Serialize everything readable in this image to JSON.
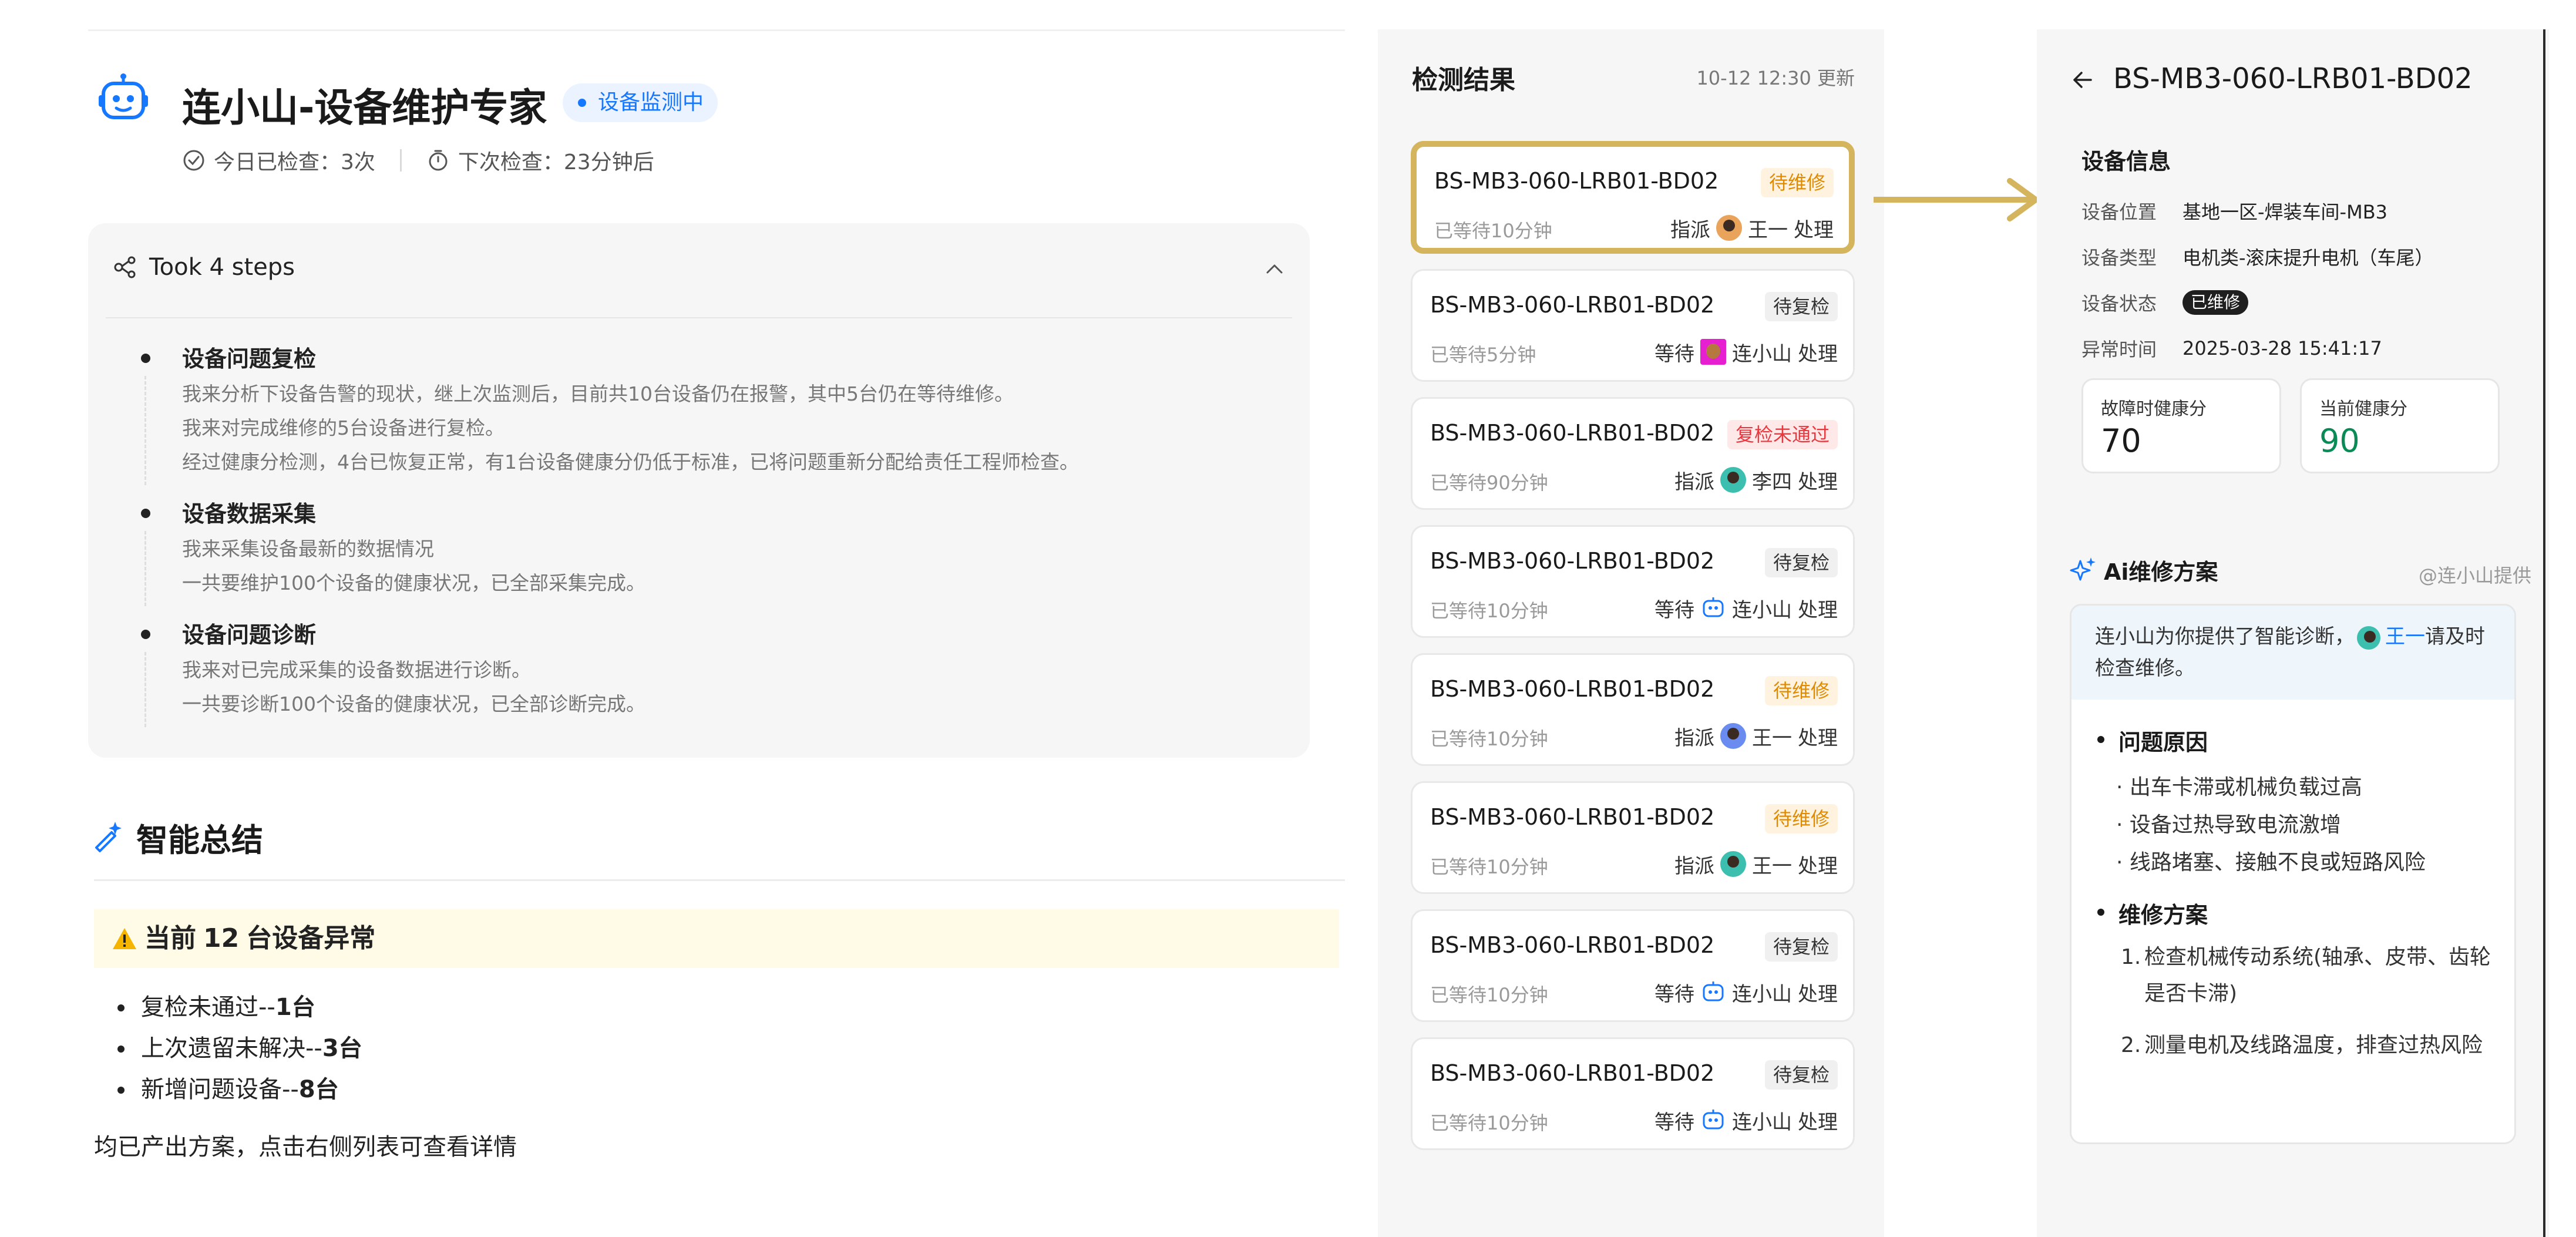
{
  "header": {
    "title": "连小山-设备维护专家",
    "status_badge": "设备监测中",
    "checked_today": "今日已检查：3次",
    "next_check": "下次检查：23分钟后"
  },
  "steps": {
    "summary": "Took 4 steps",
    "items": [
      {
        "title": "设备问题复检",
        "lines": [
          "我来分析下设备告警的现状，继上次监测后，目前共10台设备仍在报警，其中5台仍在等待维修。",
          "我来对完成维修的5台设备进行复检。",
          "经过健康分检测，4台已恢复正常，有1台设备健康分仍低于标准，已将问题重新分配给责任工程师检查。"
        ]
      },
      {
        "title": "设备数据采集",
        "lines": [
          "我来采集设备最新的数据情况",
          "一共要维护100个设备的健康状况，已全部采集完成。"
        ]
      },
      {
        "title": "设备问题诊断",
        "lines": [
          "我来对已完成采集的设备数据进行诊断。",
          "一共要诊断100个设备的健康状况，已全部诊断完成。"
        ]
      }
    ]
  },
  "summary": {
    "title": "智能总结",
    "alert_prefix": "当前",
    "alert_count": "12",
    "alert_suffix": "台设备异常",
    "bullets": [
      {
        "label": "复检未通过--",
        "value": "1台"
      },
      {
        "label": "上次遗留未解决--",
        "value": "3台"
      },
      {
        "label": "新增问题设备--",
        "value": "8台"
      }
    ],
    "footer": "均已产出方案，点击右侧列表可查看详情"
  },
  "results": {
    "title": "检测结果",
    "updated": "10-12 12:30 更新",
    "items": [
      {
        "code": "BS-MB3-060-LRB01-BD02",
        "wait": "已等待10分钟",
        "tag": "待维修",
        "tag_color": "orange",
        "action": "指派",
        "person": "王一",
        "suffix": "处理",
        "avatar": "person-orange"
      },
      {
        "code": "BS-MB3-060-LRB01-BD02",
        "wait": "已等待5分钟",
        "tag": "待复检",
        "tag_color": "gray",
        "action": "等待",
        "person": "连小山",
        "suffix": "处理",
        "avatar": "magenta"
      },
      {
        "code": "BS-MB3-060-LRB01-BD02",
        "wait": "已等待90分钟",
        "tag": "复检未通过",
        "tag_color": "red",
        "action": "指派",
        "person": "李四",
        "suffix": "处理",
        "avatar": "person-teal"
      },
      {
        "code": "BS-MB3-060-LRB01-BD02",
        "wait": "已等待10分钟",
        "tag": "待复检",
        "tag_color": "gray",
        "action": "等待",
        "person": "连小山",
        "suffix": "处理",
        "avatar": "bot"
      },
      {
        "code": "BS-MB3-060-LRB01-BD02",
        "wait": "已等待10分钟",
        "tag": "待维修",
        "tag_color": "orange",
        "action": "指派",
        "person": "王一",
        "suffix": "处理",
        "avatar": "person-blue"
      },
      {
        "code": "BS-MB3-060-LRB01-BD02",
        "wait": "已等待10分钟",
        "tag": "待维修",
        "tag_color": "orange",
        "action": "指派",
        "person": "王一",
        "suffix": "处理",
        "avatar": "person-teal"
      },
      {
        "code": "BS-MB3-060-LRB01-BD02",
        "wait": "已等待10分钟",
        "tag": "待复检",
        "tag_color": "gray",
        "action": "等待",
        "person": "连小山",
        "suffix": "处理",
        "avatar": "bot"
      },
      {
        "code": "BS-MB3-060-LRB01-BD02",
        "wait": "已等待10分钟",
        "tag": "待复检",
        "tag_color": "gray",
        "action": "等待",
        "person": "连小山",
        "suffix": "处理",
        "avatar": "bot"
      }
    ]
  },
  "detail": {
    "title": "BS-MB3-060-LRB01-BD02",
    "info_title": "设备信息",
    "rows": [
      {
        "key": "设备位置",
        "value": "基地一区-焊装车间-MB3"
      },
      {
        "key": "设备类型",
        "value": "电机类-滚床提升电机（车尾）"
      },
      {
        "key": "设备状态",
        "value": "已维修"
      },
      {
        "key": "异常时间",
        "value": "2025-03-28 15:41:17"
      }
    ],
    "score_fault_label": "故障时健康分",
    "score_fault_value": "70",
    "score_now_label": "当前健康分",
    "score_now_value": "90",
    "ai_title": "Ai维修方案",
    "ai_provider": "@连小山提供",
    "ai_intro_a": "连小山为你提供了智能诊断，",
    "ai_intro_mention": "王一",
    "ai_intro_b": "请及时检查维修。",
    "cause_title": "问题原因",
    "causes": [
      "· 出车卡滞或机械负载过高",
      "· 设备过热导致电流激增",
      "· 线路堵塞、接触不良或短路风险"
    ],
    "plan_title": "维修方案",
    "plan": [
      {
        "n": "1.",
        "t": "检查机械传动系统(轴承、皮带、齿轮是否卡滞)"
      },
      {
        "n": "2.",
        "t": "测量电机及线路温度，排查过热风险"
      }
    ]
  },
  "colors": {
    "accent": "#1677ff",
    "highlight": "#d4b45c",
    "warn": "#e08a00",
    "danger": "#e5393f",
    "success": "#0a8a55"
  }
}
